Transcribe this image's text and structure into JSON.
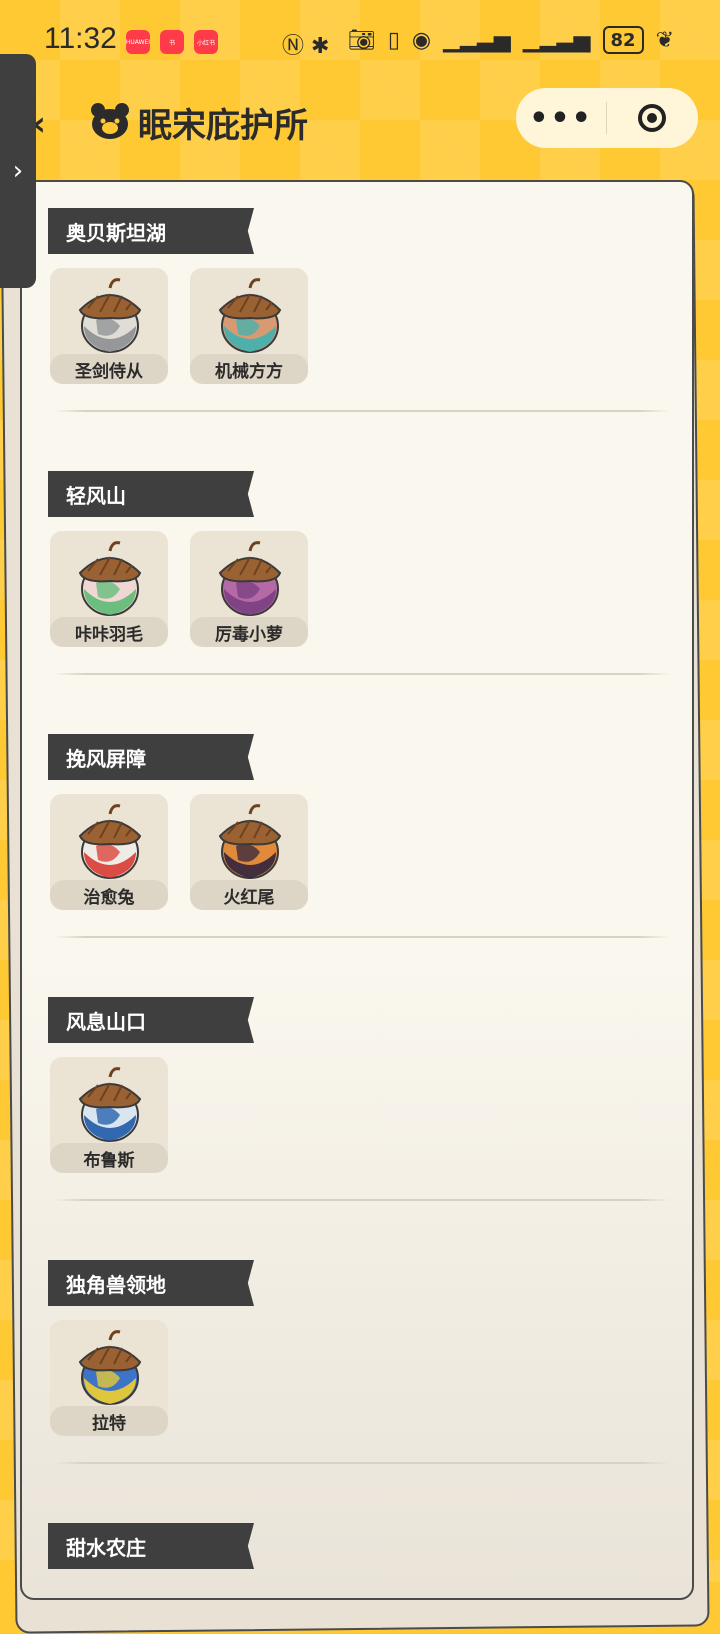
{
  "status_bar": {
    "time": "11:32",
    "app_icons": [
      "HUAWEI",
      "书",
      "小红书"
    ],
    "battery": "82"
  },
  "header": {
    "title": "眠宋庇护所",
    "more_label": "•••"
  },
  "sections": [
    {
      "title": "奥贝斯坦湖",
      "pets": [
        {
          "name": "圣剑侍从",
          "colors": [
            "#8e8f92",
            "#e0ddd6"
          ]
        },
        {
          "name": "机械方方",
          "colors": [
            "#3fb3b0",
            "#d89a72"
          ]
        }
      ]
    },
    {
      "title": "轻风山",
      "pets": [
        {
          "name": "咔咔羽毛",
          "colors": [
            "#5dbb74",
            "#f0d7d4"
          ]
        },
        {
          "name": "厉毒小萝",
          "colors": [
            "#7a3f82",
            "#b56aa5"
          ]
        }
      ]
    },
    {
      "title": "挽风屏障",
      "pets": [
        {
          "name": "治愈兔",
          "colors": [
            "#d83b33",
            "#efece6"
          ]
        },
        {
          "name": "火红尾",
          "colors": [
            "#32243f",
            "#e08a3a"
          ]
        }
      ]
    },
    {
      "title": "风息山口",
      "pets": [
        {
          "name": "布鲁斯",
          "colors": [
            "#1e5aa8",
            "#d9e6f0"
          ]
        }
      ]
    },
    {
      "title": "独角兽领地",
      "pets": [
        {
          "name": "拉特",
          "colors": [
            "#f1cf2e",
            "#3e74c7"
          ]
        }
      ]
    },
    {
      "title": "甜水农庄",
      "pets": []
    }
  ]
}
